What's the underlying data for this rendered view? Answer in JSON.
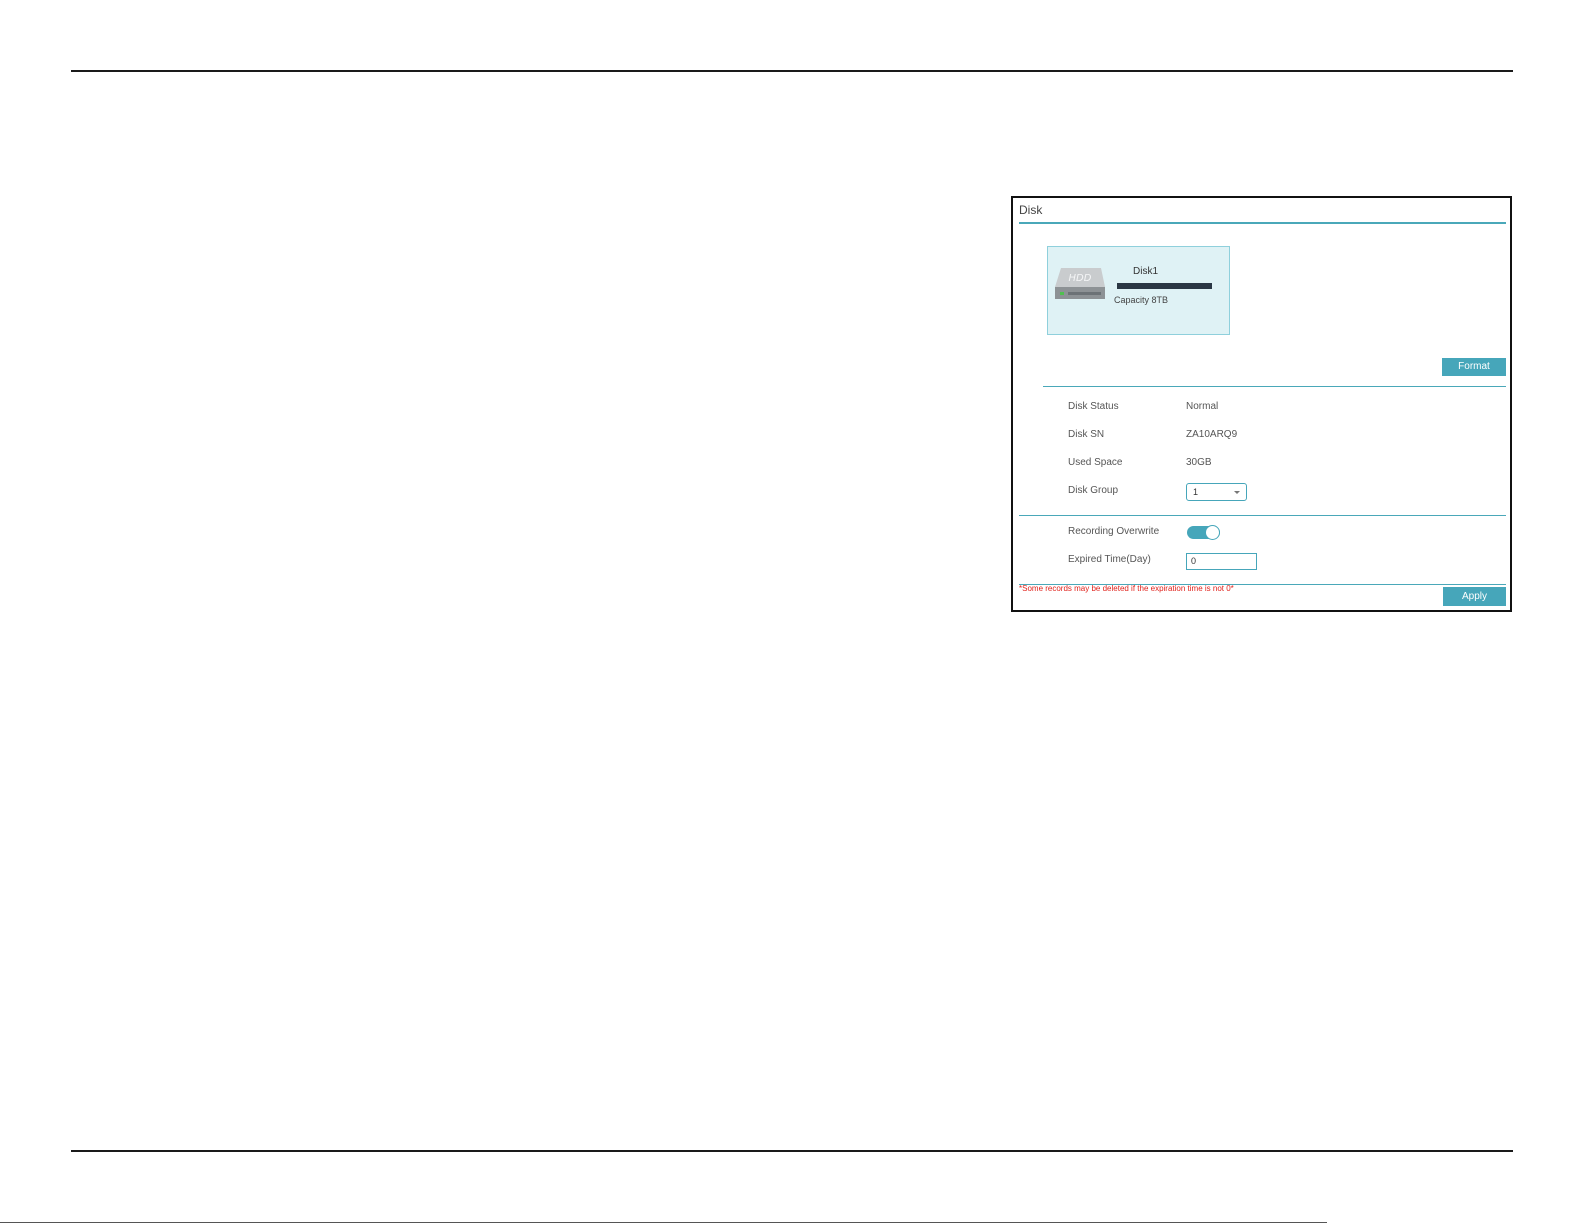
{
  "panel": {
    "title": "Disk"
  },
  "disk": {
    "name": "Disk1",
    "icon_label": "HDD",
    "capacity": "Capacity 8TB",
    "usage_fraction": 1.0
  },
  "buttons": {
    "format": "Format",
    "apply": "Apply"
  },
  "info": {
    "status_label": "Disk Status",
    "status_value": "Normal",
    "sn_label": "Disk SN",
    "sn_value": "ZA10ARQ9",
    "used_label": "Used Space",
    "used_value": "30GB",
    "group_label": "Disk Group",
    "group_value": "1"
  },
  "settings": {
    "overwrite_label": "Recording Overwrite",
    "overwrite_on": true,
    "expired_label": "Expired Time(Day)",
    "expired_value": "0"
  },
  "warning": "*Some records may be deleted if the expiration time is not 0*",
  "colors": {
    "accent": "#46a6ba",
    "card_bg": "#dff2f5",
    "warning": "#e0201a"
  }
}
